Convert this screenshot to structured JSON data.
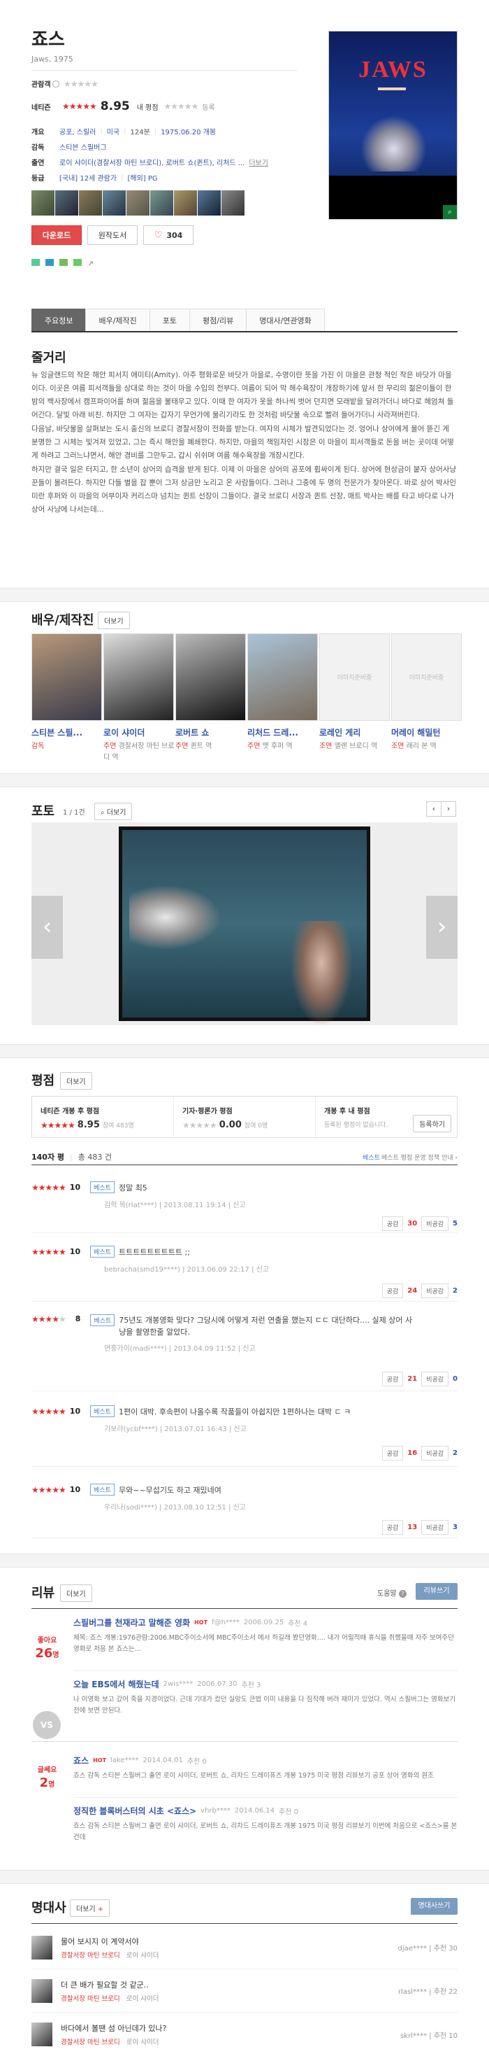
{
  "movie": {
    "title": "죠스",
    "subtitle": "Jaws, 1975",
    "rating_label": "관람객",
    "netizen_label": "네티즌",
    "netizen_score": "8.95",
    "my_label": "내 평점",
    "register": "등록",
    "info": {
      "genre_label": "개요",
      "genre": "공포, 스릴러",
      "country": "미국",
      "runtime": "124분",
      "release": "1975.06.20 개봉",
      "director_label": "감독",
      "director": "스티븐 스필버그",
      "cast_label": "출연",
      "cast": "로이 샤이더(경찰서장 마틴 브로디), 로버트 쇼(퀸트), 리처드 ...",
      "more": "더보기",
      "grade_label": "등급",
      "grade": "[국내] 12세 관람가",
      "grade_extra": "[해외] PG"
    },
    "poster_title": "JAWS",
    "buttons": {
      "download": "다운로드",
      "original": "원작도서",
      "like": "304"
    }
  },
  "tabs": [
    "주요정보",
    "배우/제작진",
    "포토",
    "평점/리뷰",
    "명대사/연관영화"
  ],
  "story": {
    "title": "줄거리",
    "p1": "뉴 잉글랜드의 작은 해안 피서지 애미티(Amity). 아주 평화로운 바닷가 마을로, 수영이란 뜻을 가진 이 마을은 관청 적인 작은 바닷가 마을이다. 이곳은 여름 피서객들을 상대로 하는 것이 마을 수입의 전부다. 여름이 되어 막 해수욕장이 개장하기에 앞서 한 무리의 젊은이들이 한밤의 백사장에서 캠프파이어를 하며 젊음을 불태우고 있다. 이때 한 여자가 옷을 하나씩 벗어 던지면 모래밭을 달려가더니 바다로 헤엄쳐 들어간다. 달빛 아래 비친. 하지만 그 여자는 갑자기 무언가에 물리기라도 한 것처럼 바닷물 속으로 빨려 들어가더니 사라져버린다.",
    "p2": "다음날, 바닷물을 살펴보는 도시 출신의 브로디 경찰서장이 전화를 받는다. 여자의 시체가 발견되었다는 것. 엉어나 상어에게 물어 뜯긴 게 분명한 그 시체는 빛겨져 있었고, 그는 즉시 해안을 폐쇄한다. 하지만, 마을의 책임자인 시장은 이 마을이 피서객들로 돈을 버는 곳이데 어떻게 하려고 그러느냐면서, 해안 경비를 그만두고, 갑시 쉬쉬며 여름 해수욕장을 개장시킨다.",
    "p3": "하지만 결국 일은 터지고, 한 소년이 상어의 습격을 받게 된다. 이제 이 마을은 상어의 공포에 휩싸이게 된다. 상어에 현상금이 붙자 상어사냥꾼들이 몰려든다. 하지만 다들 별을 잡 뿐이 그저 상금만 노리고 온 사람들이다. 그러나 그중에 두 명의 전문가가 찾아온다. 바로 상어 박사인 미란 후퍼와 이 마을의 어부이자 커리스마 넘치는 퀸트 선장이 그들이다. 결국 브로디 서장과 퀸트 선장, 매트 박사는 배를 타고 바다로 나가 상어 사냥에 나서는데..."
  },
  "cast_section": {
    "title": "배우/제작진",
    "more": "더보기",
    "people": [
      {
        "name": "스티븐 스필...",
        "role": "감독",
        "sub": ""
      },
      {
        "name": "로이 샤이더",
        "role": "주연",
        "sub": "경찰서장 마틴 브로디 역"
      },
      {
        "name": "로버트 쇼",
        "role": "주연",
        "sub": "퀸트 역"
      },
      {
        "name": "리처드 드레...",
        "role": "주연",
        "sub": "맷 후퍼 역"
      },
      {
        "name": "로레인 게리",
        "role": "조연",
        "sub": "엘렌 브로디 역"
      },
      {
        "name": "머레이 해밀턴",
        "role": "조연",
        "sub": "래리 본 역"
      }
    ],
    "no_image": "이미지준비중"
  },
  "photo_section": {
    "title": "포토",
    "count": "1 / 1건",
    "more": "더보기"
  },
  "score_section": {
    "title": "평점",
    "more": "더보기",
    "box1_label": "네티즌 개봉 후 평점",
    "box1_score": "8.95",
    "box1_count": "참여 483명",
    "box2_label": "기자·평론가 평점",
    "box2_score": "0.00",
    "box2_count": "참여 0명",
    "box3_label": "개봉 후 내 평점",
    "box3_sub": "등록된 평점이 없습니다.",
    "box3_btn": "등록하기",
    "count_label": "140자 평",
    "total": "총 483 건",
    "policy": "베스트 평점 운영 정책 안내",
    "reviews": [
      {
        "score": "10",
        "text": "정말 최5",
        "user": "김혁 목(rlat****)",
        "date": "2013.08.11 19:14",
        "report": "신고",
        "up": "30",
        "down": "5"
      },
      {
        "score": "10",
        "text": "트트트트트트트트트 ;;",
        "user": "bebracha(smd19****)",
        "date": "2013.06.09 22:17",
        "report": "신고",
        "up": "24",
        "down": "2"
      },
      {
        "score": "8",
        "text": "75년도 개봉영화 맞다? 그당시에 어떻게 저런 연출을 했는지 ㄷㄷ 대단하다.... 실제 상어 사냥을 촬영한줄 알았다.",
        "user": "연흥가이(madi****)",
        "date": "2013.04.09 11:52",
        "report": "신고",
        "up": "21",
        "down": "0"
      },
      {
        "score": "10",
        "text": "1편이 대박. 후속편이 나올수록 작품들이 아쉽지만 1편하나는 대박 ㄷ ㅋ",
        "user": "기보라(ycbf****)",
        "date": "2013.07.01 16:43",
        "report": "신고",
        "up": "16",
        "down": "2"
      },
      {
        "score": "10",
        "text": "무와~~무섭기도 하고 재밌네여",
        "user": "우리나(sodi****)",
        "date": "2013.08.10 12:51",
        "report": "신고",
        "up": "13",
        "down": "3"
      }
    ],
    "up_label": "공감",
    "down_label": "비공감",
    "best": "베스트"
  },
  "review_section": {
    "title": "리뷰",
    "more": "더보기",
    "help": "도움말",
    "write": "리뷰쓰기",
    "like_label": "좋아요",
    "like_count": "26",
    "like_unit": "명",
    "ok_label": "글쎄요",
    "ok_count": "2",
    "vs": "VS",
    "items": [
      {
        "title": "스필버그를 천재라고 말해준 영화",
        "hot": "HOT",
        "user": "f@h****",
        "date": "2006.09.25",
        "rec": "추천 4",
        "text": "제목: 죠스 개봉:1976관람:2006.MBC주이소서에 MBC주이소서 에서 하길래 봤던영화.... 내가 어릴적때 휴식을 취했을때 자주 보여주던 영화로 처음 본 죠스는..."
      },
      {
        "title": "오늘 EBS에서 해줬는데",
        "hot": "",
        "user": "2wis****",
        "date": "2006.07.30",
        "rec": "추천 3",
        "text": "나 이영화 보고 갔어 죽을 지경이었다. 근데 기대가 컸던 실망도 큰법 이미 내용을 다 짐작해 버려 재미가 있었다. 역시 스필버그는 영화보기전에 보면 안된다."
      },
      {
        "title": "죠스",
        "hot": "HOT",
        "user": "lake****",
        "date": "2014.04.01",
        "rec": "추천 0",
        "text": "죠스 감독 스티븐 스필버그 출연 로이 샤이더, 로버트 쇼, 리차드 드레이퓨즈 개봉 1975 미국 평점 리뷰보기 공포 상어 영화의 원조"
      },
      {
        "title": "정직한 블록버스터의 시초 <죠스>",
        "hot": "",
        "user": "vhrb****",
        "date": "2014.06.14",
        "rec": "추천 0",
        "text": "죠스 감독 스티븐 스필버그 출연 로이 샤이더, 로버트 쇼, 리차드 드레이퓨즈 개봉 1975 미국 평점 리뷰보기 이번에 처음으로 <죠스>를 본건데"
      }
    ]
  },
  "quote_section": {
    "title": "명대사",
    "more": "더보기",
    "write": "명대사쓰기",
    "items": [
      {
        "text": "물어 보시지 이 계약서야",
        "who": "경찰서장 마틴 브로디",
        "actor": "로이 샤이더",
        "user": "djae****",
        "rec": "추천 30"
      },
      {
        "text": "더 큰 배가 필요할 것 같군..",
        "who": "경찰서장 마틴 브로디",
        "actor": "로이 샤이더",
        "user": "rlasl****",
        "rec": "추천 22"
      },
      {
        "text": "바다에서 볼땐 섬 아닌데가 있나?",
        "who": "경찰서장 마틴 브로디",
        "actor": "로이 샤이더",
        "user": "skrl****",
        "rec": "추천 10"
      }
    ]
  }
}
